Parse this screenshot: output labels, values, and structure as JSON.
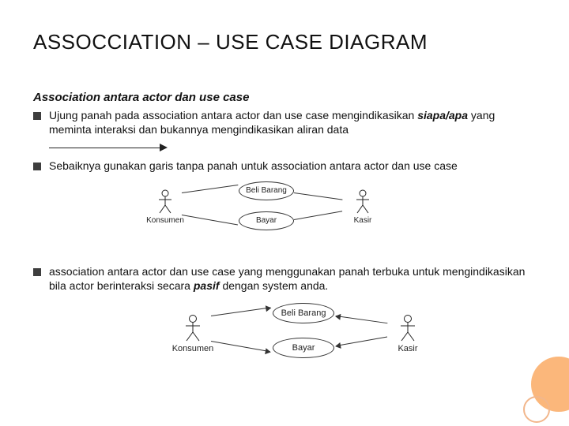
{
  "title": "ASSOCCIATION – USE CASE DIAGRAM",
  "subsection": "Association antara actor dan use case",
  "bullets": {
    "b1_pre": "Ujung panah pada association antara actor dan use case mengindikasikan ",
    "b1_em": "siapa/apa",
    "b1_post": " yang meminta interaksi dan bukannya mengindikasikan aliran data",
    "b2": "Sebaiknya gunakan garis tanpa panah untuk association antara actor dan use case",
    "b3_pre": "association antara actor dan use case yang menggunakan panah terbuka untuk mengindikasikan bila actor berinteraksi secara ",
    "b3_em": "pasif",
    "b3_post": " dengan system anda."
  },
  "uml": {
    "actor_left": "Konsumen",
    "actor_right": "Kasir",
    "usecase_top": "Beli Barang",
    "usecase_bottom": "Bayar"
  }
}
